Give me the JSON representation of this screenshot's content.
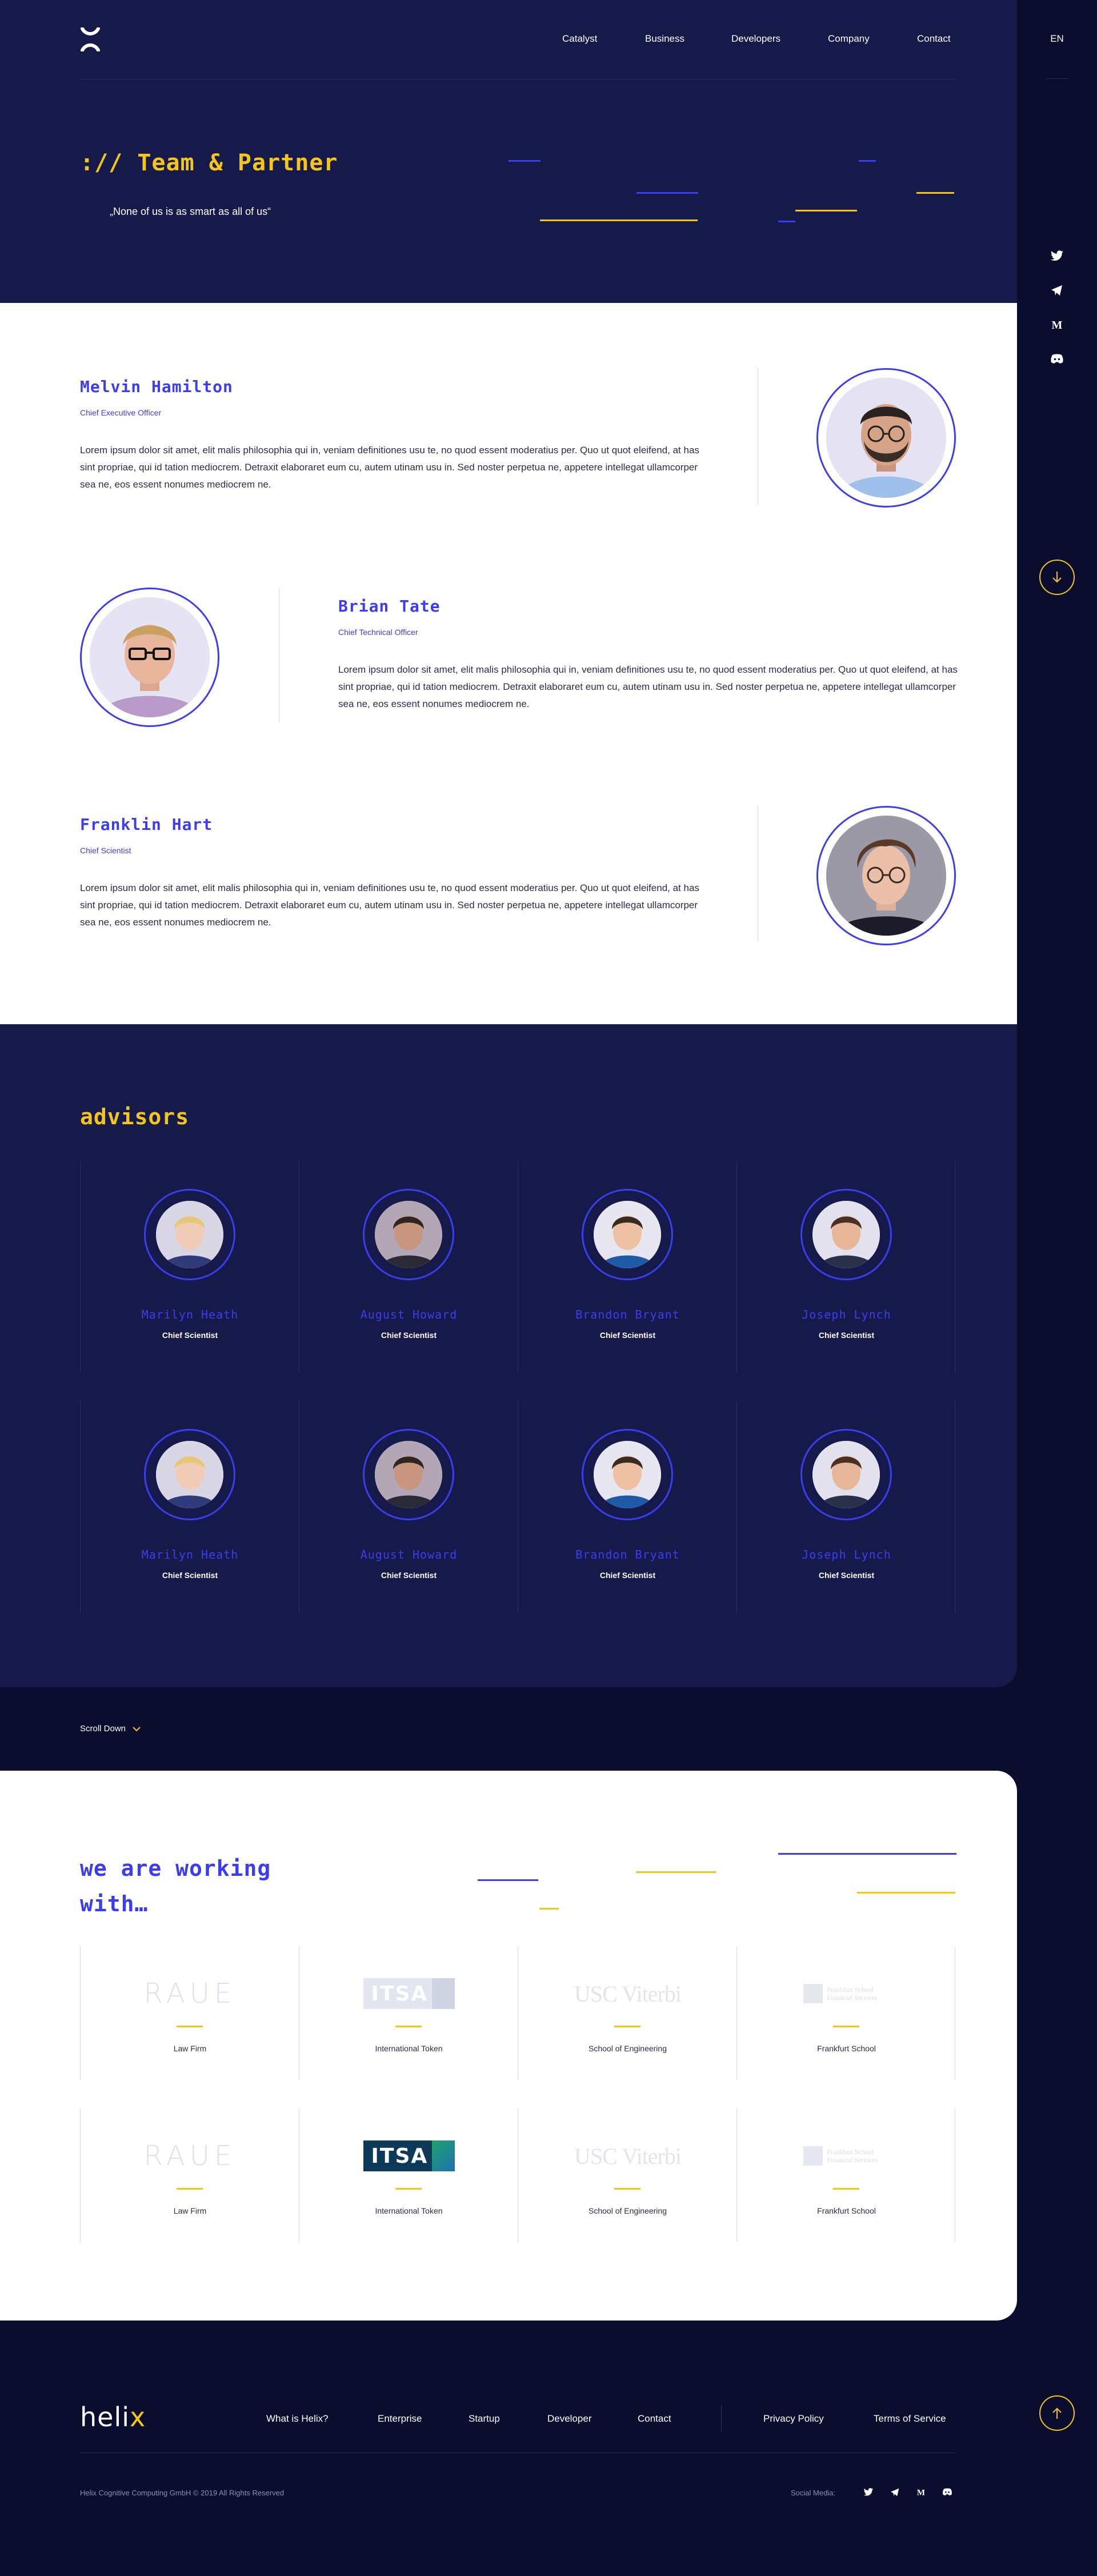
{
  "header": {
    "nav": [
      "Catalyst",
      "Business",
      "Developers",
      "Company",
      "Contact"
    ],
    "lang": "EN"
  },
  "hero": {
    "title": ":// Team & Partner",
    "quote": "„None of us is as smart as all of us“"
  },
  "social_icons": [
    "twitter-icon",
    "telegram-icon",
    "medium-icon",
    "discord-icon"
  ],
  "team": [
    {
      "name": "Melvin Hamilton",
      "role": "Chief Executive Officer",
      "bio": "Lorem ipsum dolor sit amet, elit malis philosophia qui in, veniam definitiones usu te, no quod essent moderatius per. Quo ut quot eleifend, at has sint propriae, qui id tation mediocrem. Detraxit elaboraret eum cu, autem utinam usu in. Sed noster perpetua ne, appetere intellegat ullamcorper sea ne, eos essent nonumes mediocrem ne."
    },
    {
      "name": "Brian Tate",
      "role": "Chief Technical Officer",
      "bio": "Lorem ipsum dolor sit amet, elit malis philosophia qui in, veniam definitiones usu te, no quod essent moderatius per. Quo ut quot eleifend, at has sint propriae, qui id tation mediocrem. Detraxit elaboraret eum cu, autem utinam usu in. Sed noster perpetua ne, appetere intellegat ullamcorper sea ne, eos essent nonumes mediocrem ne."
    },
    {
      "name": "Franklin Hart",
      "role": "Chief Scientist",
      "bio": "Lorem ipsum dolor sit amet, elit malis philosophia qui in, veniam definitiones usu te, no quod essent moderatius per. Quo ut quot eleifend, at has sint propriae, qui id tation mediocrem. Detraxit elaboraret eum cu, autem utinam usu in. Sed noster perpetua ne, appetere intellegat ullamcorper sea ne, eos essent nonumes mediocrem ne."
    }
  ],
  "advisors": {
    "title": "advisors",
    "people": [
      {
        "name": "Marilyn Heath",
        "role": "Chief Scientist"
      },
      {
        "name": "August Howard",
        "role": "Chief Scientist"
      },
      {
        "name": "Brandon Bryant",
        "role": "Chief Scientist"
      },
      {
        "name": "Joseph Lynch",
        "role": "Chief Scientist"
      },
      {
        "name": "Marilyn Heath",
        "role": "Chief Scientist"
      },
      {
        "name": "August Howard",
        "role": "Chief Scientist"
      },
      {
        "name": "Brandon Bryant",
        "role": "Chief Scientist"
      },
      {
        "name": "Joseph Lynch",
        "role": "Chief Scientist"
      }
    ]
  },
  "scroll_down": "Scroll Down",
  "partners": {
    "title_line1": "we are working",
    "title_line2": "with…",
    "items": [
      {
        "logo": "RAUE",
        "label": "Law Firm"
      },
      {
        "logo": "ITSA",
        "label": "International Token"
      },
      {
        "logo": "USC Viterbi",
        "label": "School of Engineering"
      },
      {
        "logo": "Frankfurt School Financial Services",
        "label": "Frankfurt School"
      },
      {
        "logo": "RAUE",
        "label": "Law Firm"
      },
      {
        "logo": "ITSA",
        "label": "International Token"
      },
      {
        "logo": "USC Viterbi",
        "label": "School of Engineering"
      },
      {
        "logo": "Frankfurt School Financial Services",
        "label": "Frankfurt School"
      }
    ]
  },
  "footer": {
    "logo_main": "heli",
    "logo_accent": "x",
    "nav": [
      "What is Helix?",
      "Enterprise",
      "Startup",
      "Developer",
      "Contact"
    ],
    "legal": [
      "Privacy Policy",
      "Terms of Service"
    ],
    "copyright": "Helix Cognitive Computing GmbH © 2019 All Rights Reserved",
    "social_label": "Social Media:"
  },
  "colors": {
    "accent_yellow": "#f5c518",
    "accent_blue": "#3d3df0",
    "navy": "#161a4a",
    "dark": "#0b0d2e"
  }
}
